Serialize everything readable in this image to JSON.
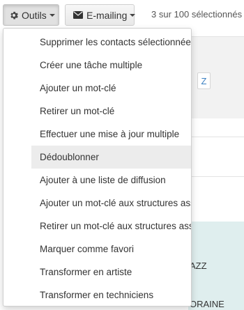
{
  "toolbar": {
    "outils_label": "Outils",
    "emailing_label": "E-mailing",
    "selection_count": "3 sur 100 sélectionnés"
  },
  "background": {
    "alpha_letter": "Z",
    "row_text_1": "AZZ",
    "row_text_2": "ORAINE"
  },
  "menu": {
    "items": [
      {
        "label": "Supprimer les contacts sélectionnées"
      },
      {
        "label": "Créer une tâche multiple"
      },
      {
        "label": "Ajouter un mot-clé"
      },
      {
        "label": "Retirer un mot-clé"
      },
      {
        "label": "Effectuer une mise à jour multiple"
      },
      {
        "label": "Dédoublonner"
      },
      {
        "label": "Ajouter à une liste de diffusion"
      },
      {
        "label": "Ajouter un mot-clé aux structures associées"
      },
      {
        "label": "Retirer un mot-clé aux structures associées"
      },
      {
        "label": "Marquer comme favori"
      },
      {
        "label": "Transformer en artiste"
      },
      {
        "label": "Transformer en techniciens"
      }
    ],
    "active_index": 5
  },
  "icons": {
    "outils": "gear-icon",
    "emailing": "envelope-icon",
    "dropdown": "caret-down-icon"
  }
}
